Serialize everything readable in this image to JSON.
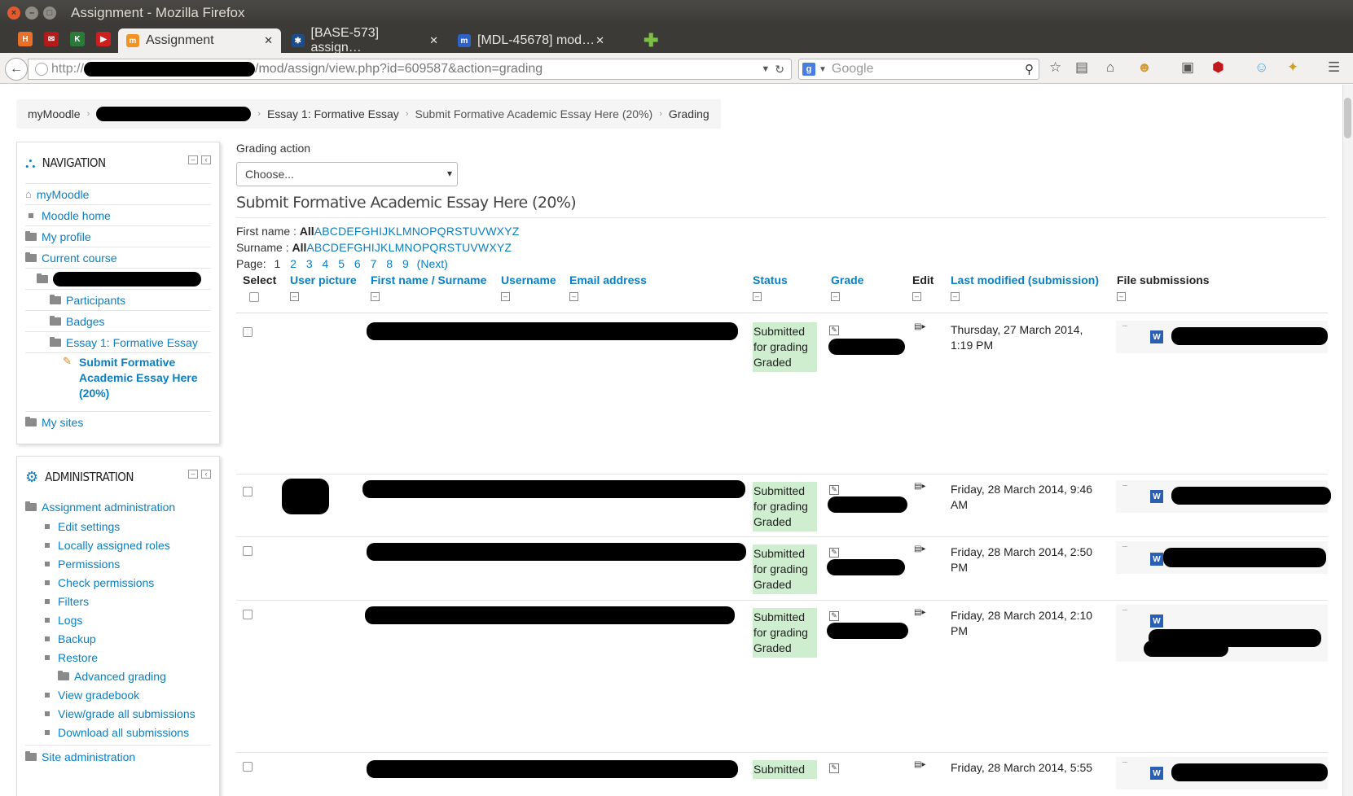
{
  "window": {
    "title": "Assignment - Mozilla Firefox"
  },
  "tabs": [
    {
      "label": "Assignment",
      "active": true
    },
    {
      "label": "[BASE-573] assign…"
    },
    {
      "label": "[MDL-45678] mod…"
    }
  ],
  "address": {
    "url_prefix": "http://",
    "url_suffix": "/mod/assign/view.php?id=609587&action=grading"
  },
  "search": {
    "placeholder": "Google"
  },
  "breadcrumb": [
    "myMoodle",
    "Essay 1: Formative Essay",
    "Submit Formative Academic Essay Here (20%)",
    "Grading"
  ],
  "navigation": {
    "title": "Navigation",
    "items": {
      "mymoodle": "myMoodle",
      "moodle_home": "Moodle home",
      "my_profile": "My profile",
      "current_course": "Current course",
      "participants": "Participants",
      "badges": "Badges",
      "essay1": "Essay 1: Formative Essay",
      "submit_formative": "Submit Formative Academic Essay Here (20%)",
      "my_sites": "My sites"
    }
  },
  "administration": {
    "title": "Administration",
    "assignment_admin": "Assignment administration",
    "items": [
      "Edit settings",
      "Locally assigned roles",
      "Permissions",
      "Check permissions",
      "Filters",
      "Logs",
      "Backup",
      "Restore"
    ],
    "advanced_grading": "Advanced grading",
    "items2": [
      "View gradebook",
      "View/grade all submissions",
      "Download all submissions"
    ],
    "site_admin": "Site administration"
  },
  "grading_action": {
    "label": "Grading action",
    "selected": "Choose..."
  },
  "heading": "Submit Formative Academic Essay Here (20%)",
  "filters": {
    "first_name_label": "First name :",
    "surname_label": "Surname :",
    "all": "All",
    "letters": "ABCDEFGHIJKLMNOPQRSTUVWXYZ",
    "page_label": "Page:",
    "current_page": "1",
    "pages": [
      "2",
      "3",
      "4",
      "5",
      "6",
      "7",
      "8",
      "9"
    ],
    "next": "(Next)"
  },
  "table": {
    "headers": {
      "select": "Select",
      "user_picture": "User picture",
      "name": "First name / Surname",
      "username": "Username",
      "email": "Email address",
      "status": "Status",
      "grade": "Grade",
      "edit": "Edit",
      "last_modified": "Last modified (submission)",
      "file_submissions": "File submissions"
    },
    "rows": [
      {
        "status": "Submitted for grading Graded",
        "modified": "Thursday, 27 March 2014, 1:19 PM"
      },
      {
        "status": "Submitted for grading Graded",
        "modified": "Friday, 28 March 2014, 9:46 AM"
      },
      {
        "status": "Submitted for grading Graded",
        "modified": "Friday, 28 March 2014, 2:50 PM"
      },
      {
        "status": "Submitted for grading Graded",
        "modified": "Friday, 28 March 2014, 2:10 PM"
      },
      {
        "status": "Submitted",
        "modified": "Friday, 28 March 2014, 5:55"
      }
    ]
  },
  "colors": {
    "link": "#0a7fc2",
    "status_bg": "#cfeecf",
    "titlebar": "#3b3a36"
  }
}
